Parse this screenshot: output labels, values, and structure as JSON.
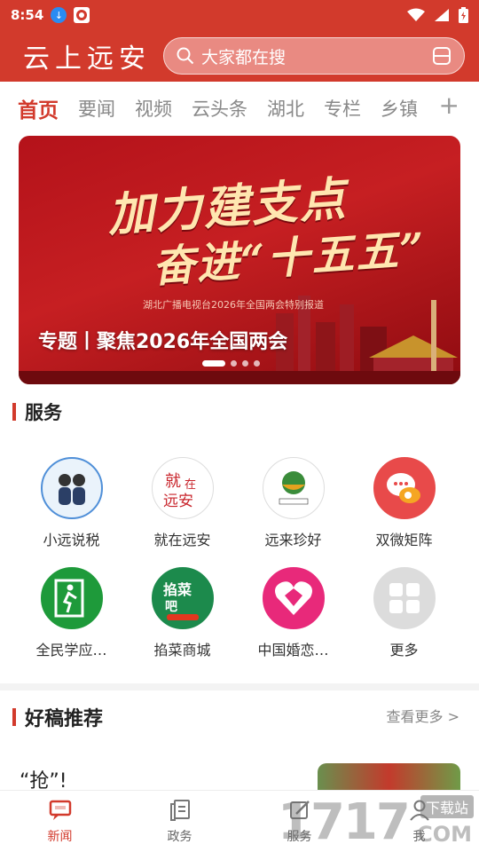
{
  "status_bar": {
    "time": "8:54"
  },
  "header": {
    "logo": "云上远安",
    "search_placeholder": "大家都在搜"
  },
  "tabs": [
    "首页",
    "要闻",
    "视频",
    "云头条",
    "湖北",
    "专栏",
    "乡镇"
  ],
  "banner": {
    "title_line1": "加力建支点",
    "title_line2": "奋进“十五五”",
    "subtitle": "湖北广播电视台2026年全国两会特别报道",
    "caption": "专题丨聚焦2026年全国两会",
    "dots": 4
  },
  "services": {
    "title": "服务",
    "items": [
      {
        "label": "小远说税",
        "icon": "tax-avatar-icon"
      },
      {
        "label": "就在远安",
        "icon": "jiuzai-yuanan-icon"
      },
      {
        "label": "远来珍好",
        "icon": "yuanlai-zhenhao-icon"
      },
      {
        "label": "双微矩阵",
        "icon": "weibo-wechat-icon"
      },
      {
        "label": "全民学应…",
        "icon": "emergency-exit-icon"
      },
      {
        "label": "掐菜商城",
        "icon": "qiacai-mall-icon"
      },
      {
        "label": "中国婚恋…",
        "icon": "heart-icon"
      },
      {
        "label": "更多",
        "icon": "more-grid-icon"
      }
    ]
  },
  "recommend": {
    "title": "好稿推荐",
    "more": "查看更多 >",
    "first_article_title": "“抢”!"
  },
  "bottom_nav": [
    {
      "label": "新闻",
      "active": true
    },
    {
      "label": "政务",
      "active": false
    },
    {
      "label": "服务",
      "active": false
    },
    {
      "label": "我",
      "active": false
    }
  ],
  "watermark": {
    "number": "1717",
    "tag": "下载站",
    "domain": "COM"
  },
  "colors": {
    "brand_red": "#d23a2c",
    "search_bg": "#e98a82"
  }
}
